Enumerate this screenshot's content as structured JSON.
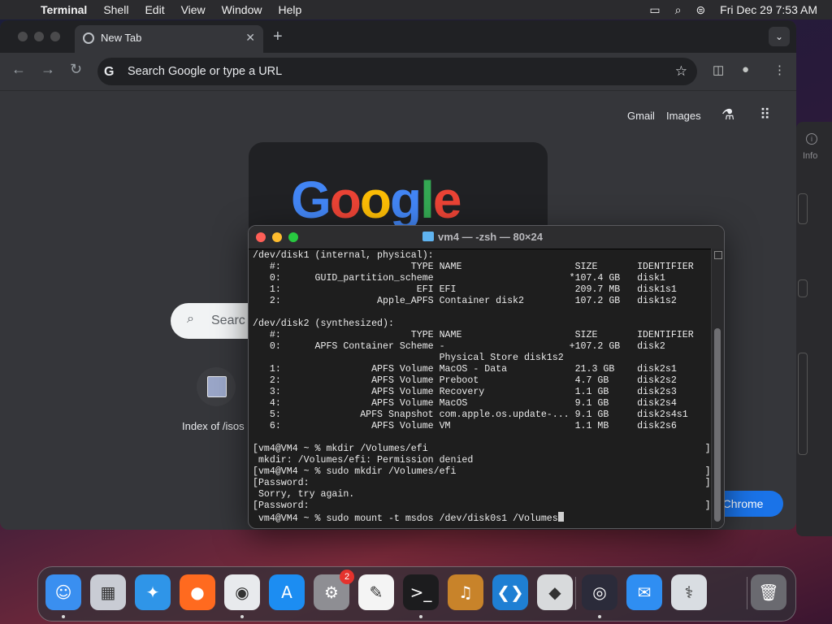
{
  "menubar": {
    "app": "Terminal",
    "items": [
      "Shell",
      "Edit",
      "View",
      "Window",
      "Help"
    ],
    "datetime": "Fri Dec 29  7:53 AM"
  },
  "chrome": {
    "tab_title": "New Tab",
    "omnibox_placeholder": "Search Google or type a URL",
    "links": {
      "gmail": "Gmail",
      "images": "Images"
    },
    "doodle_text": "Google",
    "search_pill_text": "Searc",
    "shortcut_label": "Index of /isos",
    "customize_button": "e Chrome"
  },
  "side_window": {
    "info_label": "Info"
  },
  "terminal": {
    "title": "vm4 — -zsh — 80×24",
    "lines": [
      "/dev/disk1 (internal, physical):",
      "   #:                       TYPE NAME                    SIZE       IDENTIFIER",
      "   0:      GUID_partition_scheme                        *107.4 GB   disk1",
      "   1:                        EFI EFI                     209.7 MB   disk1s1",
      "   2:                 Apple_APFS Container disk2         107.2 GB   disk1s2",
      "",
      "/dev/disk2 (synthesized):",
      "   #:                       TYPE NAME                    SIZE       IDENTIFIER",
      "   0:      APFS Container Scheme -                      +107.2 GB   disk2",
      "                                 Physical Store disk1s2",
      "   1:                APFS Volume MacOS - Data            21.3 GB    disk2s1",
      "   2:                APFS Volume Preboot                 4.7 GB     disk2s2",
      "   3:                APFS Volume Recovery                1.1 GB     disk2s3",
      "   4:                APFS Volume MacOS                   9.1 GB     disk2s4",
      "   5:              APFS Snapshot com.apple.os.update-... 9.1 GB     disk2s4s1",
      "   6:                APFS Volume VM                      1.1 MB     disk2s6",
      "",
      "[vm4@VM4 ~ % mkdir /Volumes/efi                                                 ]",
      " mkdir: /Volumes/efi: Permission denied",
      "[vm4@VM4 ~ % sudo mkdir /Volumes/efi                                            ]",
      "[Password:                                                                      ]",
      " Sorry, try again.",
      "[Password:                                                                      ]",
      " vm4@VM4 ~ % sudo mount -t msdos /dev/disk0s1 /Volumes"
    ]
  },
  "dock": {
    "apps": [
      {
        "name": "Finder",
        "icon": "finder-icon",
        "glyph": "☺",
        "color": "#3a8ff0",
        "running": true
      },
      {
        "name": "Launchpad",
        "icon": "launchpad-icon",
        "glyph": "▦",
        "color": "#c9ccd4",
        "running": false
      },
      {
        "name": "Safari",
        "icon": "safari-icon",
        "glyph": "✦",
        "color": "#2f95e8",
        "running": false
      },
      {
        "name": "Firefox",
        "icon": "firefox-icon",
        "glyph": "●",
        "color": "#ff6a1f",
        "running": false
      },
      {
        "name": "Chrome",
        "icon": "chrome-icon",
        "glyph": "◉",
        "color": "#e8eaed",
        "running": true
      },
      {
        "name": "App Store",
        "icon": "app-store-icon",
        "glyph": "A",
        "color": "#1c8df2",
        "running": false
      },
      {
        "name": "System Settings",
        "icon": "system-settings-icon",
        "glyph": "⚙",
        "color": "#8e8e93",
        "running": false,
        "badge": "2"
      },
      {
        "name": "TextEdit",
        "icon": "textedit-icon",
        "glyph": "✎",
        "color": "#f4f4f4",
        "running": false
      },
      {
        "name": "Terminal",
        "icon": "terminal-icon",
        "glyph": ">_",
        "color": "#1c1c1e",
        "running": true
      },
      {
        "name": "GarageBand",
        "icon": "garageband-icon",
        "glyph": "♫",
        "color": "#c8832a",
        "running": false
      },
      {
        "name": "VS Code",
        "icon": "vscode-icon",
        "glyph": "❮❯",
        "color": "#1f7fd3",
        "running": false
      },
      {
        "name": "Roblox",
        "icon": "roblox-icon",
        "glyph": "◆",
        "color": "#d8dadc",
        "running": false
      },
      {
        "name": "OBS",
        "icon": "obs-icon",
        "glyph": "◎",
        "color": "#2b2b3a",
        "running": true
      },
      {
        "name": "Mail",
        "icon": "mail-icon",
        "glyph": "✉",
        "color": "#2f8ef2",
        "running": false
      },
      {
        "name": "Preview",
        "icon": "preview-icon",
        "glyph": "⚕",
        "color": "#d9dde2",
        "running": false
      },
      {
        "name": "Trash",
        "icon": "trash-icon",
        "glyph": "🗑",
        "color": "#6a6a70",
        "running": false
      }
    ]
  }
}
